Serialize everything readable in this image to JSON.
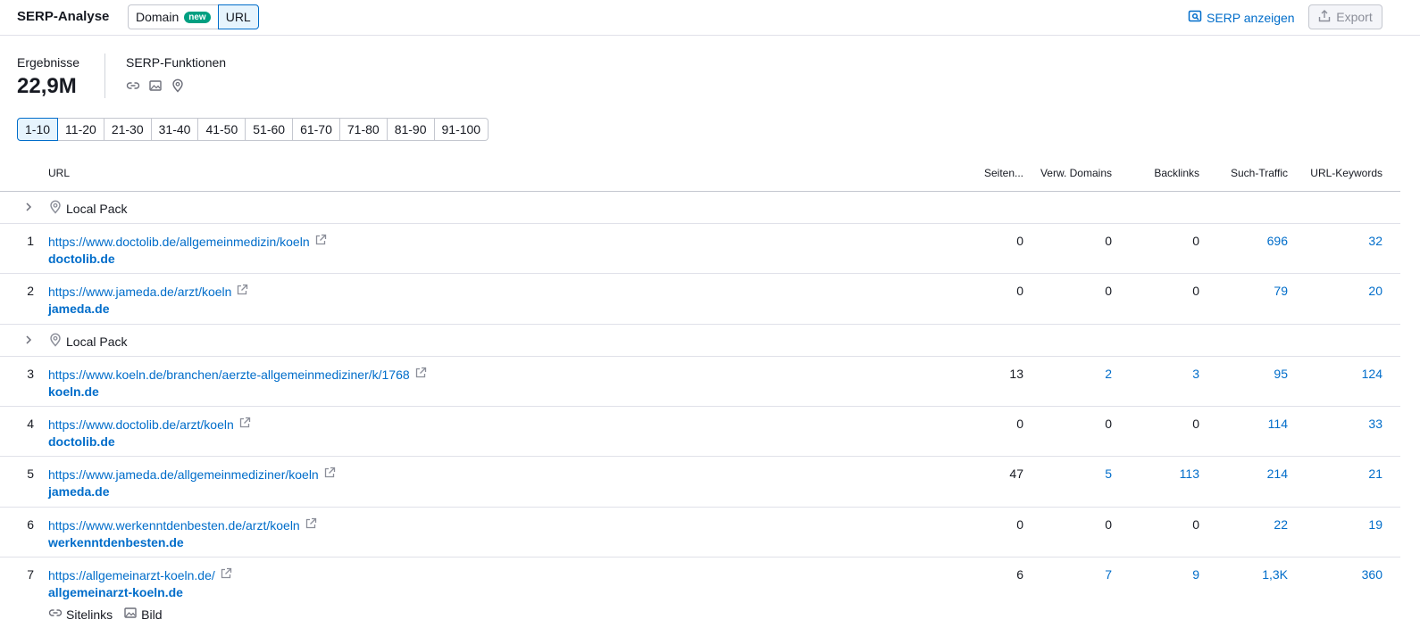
{
  "header": {
    "title": "SERP-Analyse",
    "toggle_domain": "Domain",
    "toggle_badge": "new",
    "toggle_url": "URL",
    "serp_button": "SERP anzeigen",
    "export_button": "Export"
  },
  "summary": {
    "results_label": "Ergebnisse",
    "results_value": "22,9M",
    "features_label": "SERP-Funktionen",
    "feature_icons": [
      "link-icon",
      "image-icon",
      "location-pin-icon"
    ]
  },
  "pagination": [
    "1-10",
    "11-20",
    "21-30",
    "31-40",
    "41-50",
    "51-60",
    "61-70",
    "71-80",
    "81-90",
    "91-100"
  ],
  "table": {
    "columns": {
      "url": "URL",
      "pages": "Seiten...",
      "ref_domains": "Verw. Domains",
      "backlinks": "Backlinks",
      "traffic": "Such-Traffic",
      "keywords": "URL-Keywords"
    },
    "local_pack_label": "Local Pack",
    "rows": [
      {
        "rank": "1",
        "url": "https://www.doctolib.de/allgemeinmedizin/koeln",
        "domain": "doctolib.de",
        "pages": "0",
        "ref_domains": "0",
        "backlinks": "0",
        "traffic": "696",
        "keywords": "32"
      },
      {
        "rank": "2",
        "url": "https://www.jameda.de/arzt/koeln",
        "domain": "jameda.de",
        "pages": "0",
        "ref_domains": "0",
        "backlinks": "0",
        "traffic": "79",
        "keywords": "20"
      },
      {
        "rank": "3",
        "url": "https://www.koeln.de/branchen/aerzte-allgemeinmediziner/k/1768",
        "domain": "koeln.de",
        "pages": "13",
        "ref_domains": "2",
        "backlinks": "3",
        "traffic": "95",
        "keywords": "124"
      },
      {
        "rank": "4",
        "url": "https://www.doctolib.de/arzt/koeln",
        "domain": "doctolib.de",
        "pages": "0",
        "ref_domains": "0",
        "backlinks": "0",
        "traffic": "114",
        "keywords": "33"
      },
      {
        "rank": "5",
        "url": "https://www.jameda.de/allgemeinmediziner/koeln",
        "domain": "jameda.de",
        "pages": "47",
        "ref_domains": "5",
        "backlinks": "113",
        "traffic": "214",
        "keywords": "21"
      },
      {
        "rank": "6",
        "url": "https://www.werkenntdenbesten.de/arzt/koeln",
        "domain": "werkenntdenbesten.de",
        "pages": "0",
        "ref_domains": "0",
        "backlinks": "0",
        "traffic": "22",
        "keywords": "19"
      },
      {
        "rank": "7",
        "url": "https://allgemeinarzt-koeln.de/",
        "domain": "allgemeinarzt-koeln.de",
        "pages": "6",
        "ref_domains": "7",
        "backlinks": "9",
        "traffic": "1,3K",
        "keywords": "360",
        "features": [
          "Sitelinks",
          "Bild"
        ]
      }
    ]
  },
  "colors": {
    "link": "#006dca",
    "badge": "#009f81",
    "active_bg": "#e6f4fd"
  }
}
